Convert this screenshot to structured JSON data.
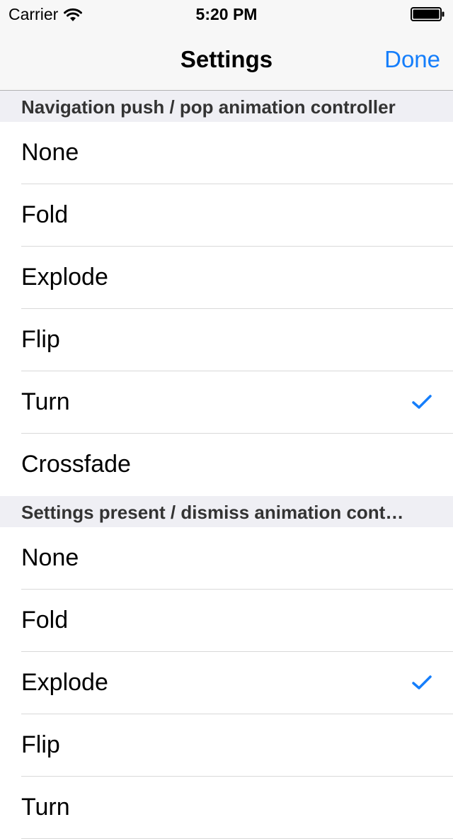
{
  "status_bar": {
    "carrier": "Carrier",
    "time": "5:20 PM"
  },
  "nav_bar": {
    "title": "Settings",
    "done_label": "Done"
  },
  "colors": {
    "accent": "#157efb",
    "header_bg": "#efeff4",
    "bar_bg": "#f7f7f7",
    "separator": "#d9d9d9"
  },
  "sections": [
    {
      "header": "Navigation push / pop animation controller",
      "items": [
        {
          "label": "None",
          "checked": false
        },
        {
          "label": "Fold",
          "checked": false
        },
        {
          "label": "Explode",
          "checked": false
        },
        {
          "label": "Flip",
          "checked": false
        },
        {
          "label": "Turn",
          "checked": true
        },
        {
          "label": "Crossfade",
          "checked": false
        }
      ]
    },
    {
      "header": "Settings present / dismiss animation cont…",
      "items": [
        {
          "label": "None",
          "checked": false
        },
        {
          "label": "Fold",
          "checked": false
        },
        {
          "label": "Explode",
          "checked": true
        },
        {
          "label": "Flip",
          "checked": false
        },
        {
          "label": "Turn",
          "checked": false
        }
      ]
    }
  ]
}
